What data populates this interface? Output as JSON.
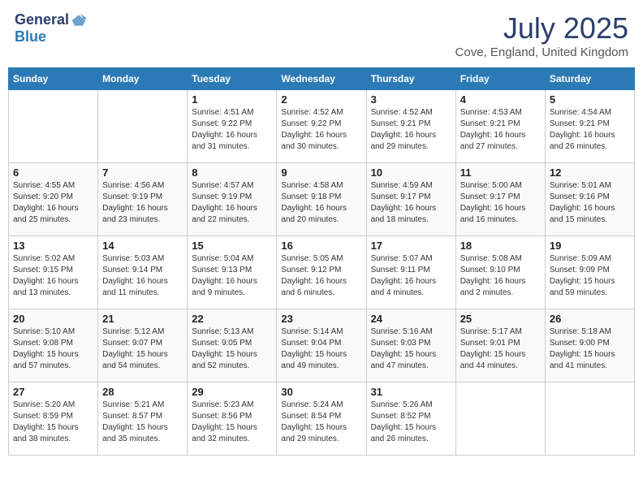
{
  "logo": {
    "text_general": "General",
    "text_blue": "Blue"
  },
  "title": {
    "month_year": "July 2025",
    "location": "Cove, England, United Kingdom"
  },
  "days_of_week": [
    "Sunday",
    "Monday",
    "Tuesday",
    "Wednesday",
    "Thursday",
    "Friday",
    "Saturday"
  ],
  "weeks": [
    [
      {
        "day": "",
        "info": ""
      },
      {
        "day": "",
        "info": ""
      },
      {
        "day": "1",
        "info": "Sunrise: 4:51 AM\nSunset: 9:22 PM\nDaylight: 16 hours\nand 31 minutes."
      },
      {
        "day": "2",
        "info": "Sunrise: 4:52 AM\nSunset: 9:22 PM\nDaylight: 16 hours\nand 30 minutes."
      },
      {
        "day": "3",
        "info": "Sunrise: 4:52 AM\nSunset: 9:21 PM\nDaylight: 16 hours\nand 29 minutes."
      },
      {
        "day": "4",
        "info": "Sunrise: 4:53 AM\nSunset: 9:21 PM\nDaylight: 16 hours\nand 27 minutes."
      },
      {
        "day": "5",
        "info": "Sunrise: 4:54 AM\nSunset: 9:21 PM\nDaylight: 16 hours\nand 26 minutes."
      }
    ],
    [
      {
        "day": "6",
        "info": "Sunrise: 4:55 AM\nSunset: 9:20 PM\nDaylight: 16 hours\nand 25 minutes."
      },
      {
        "day": "7",
        "info": "Sunrise: 4:56 AM\nSunset: 9:19 PM\nDaylight: 16 hours\nand 23 minutes."
      },
      {
        "day": "8",
        "info": "Sunrise: 4:57 AM\nSunset: 9:19 PM\nDaylight: 16 hours\nand 22 minutes."
      },
      {
        "day": "9",
        "info": "Sunrise: 4:58 AM\nSunset: 9:18 PM\nDaylight: 16 hours\nand 20 minutes."
      },
      {
        "day": "10",
        "info": "Sunrise: 4:59 AM\nSunset: 9:17 PM\nDaylight: 16 hours\nand 18 minutes."
      },
      {
        "day": "11",
        "info": "Sunrise: 5:00 AM\nSunset: 9:17 PM\nDaylight: 16 hours\nand 16 minutes."
      },
      {
        "day": "12",
        "info": "Sunrise: 5:01 AM\nSunset: 9:16 PM\nDaylight: 16 hours\nand 15 minutes."
      }
    ],
    [
      {
        "day": "13",
        "info": "Sunrise: 5:02 AM\nSunset: 9:15 PM\nDaylight: 16 hours\nand 13 minutes."
      },
      {
        "day": "14",
        "info": "Sunrise: 5:03 AM\nSunset: 9:14 PM\nDaylight: 16 hours\nand 11 minutes."
      },
      {
        "day": "15",
        "info": "Sunrise: 5:04 AM\nSunset: 9:13 PM\nDaylight: 16 hours\nand 9 minutes."
      },
      {
        "day": "16",
        "info": "Sunrise: 5:05 AM\nSunset: 9:12 PM\nDaylight: 16 hours\nand 6 minutes."
      },
      {
        "day": "17",
        "info": "Sunrise: 5:07 AM\nSunset: 9:11 PM\nDaylight: 16 hours\nand 4 minutes."
      },
      {
        "day": "18",
        "info": "Sunrise: 5:08 AM\nSunset: 9:10 PM\nDaylight: 16 hours\nand 2 minutes."
      },
      {
        "day": "19",
        "info": "Sunrise: 5:09 AM\nSunset: 9:09 PM\nDaylight: 15 hours\nand 59 minutes."
      }
    ],
    [
      {
        "day": "20",
        "info": "Sunrise: 5:10 AM\nSunset: 9:08 PM\nDaylight: 15 hours\nand 57 minutes."
      },
      {
        "day": "21",
        "info": "Sunrise: 5:12 AM\nSunset: 9:07 PM\nDaylight: 15 hours\nand 54 minutes."
      },
      {
        "day": "22",
        "info": "Sunrise: 5:13 AM\nSunset: 9:05 PM\nDaylight: 15 hours\nand 52 minutes."
      },
      {
        "day": "23",
        "info": "Sunrise: 5:14 AM\nSunset: 9:04 PM\nDaylight: 15 hours\nand 49 minutes."
      },
      {
        "day": "24",
        "info": "Sunrise: 5:16 AM\nSunset: 9:03 PM\nDaylight: 15 hours\nand 47 minutes."
      },
      {
        "day": "25",
        "info": "Sunrise: 5:17 AM\nSunset: 9:01 PM\nDaylight: 15 hours\nand 44 minutes."
      },
      {
        "day": "26",
        "info": "Sunrise: 5:18 AM\nSunset: 9:00 PM\nDaylight: 15 hours\nand 41 minutes."
      }
    ],
    [
      {
        "day": "27",
        "info": "Sunrise: 5:20 AM\nSunset: 8:59 PM\nDaylight: 15 hours\nand 38 minutes."
      },
      {
        "day": "28",
        "info": "Sunrise: 5:21 AM\nSunset: 8:57 PM\nDaylight: 15 hours\nand 35 minutes."
      },
      {
        "day": "29",
        "info": "Sunrise: 5:23 AM\nSunset: 8:56 PM\nDaylight: 15 hours\nand 32 minutes."
      },
      {
        "day": "30",
        "info": "Sunrise: 5:24 AM\nSunset: 8:54 PM\nDaylight: 15 hours\nand 29 minutes."
      },
      {
        "day": "31",
        "info": "Sunrise: 5:26 AM\nSunset: 8:52 PM\nDaylight: 15 hours\nand 26 minutes."
      },
      {
        "day": "",
        "info": ""
      },
      {
        "day": "",
        "info": ""
      }
    ]
  ]
}
